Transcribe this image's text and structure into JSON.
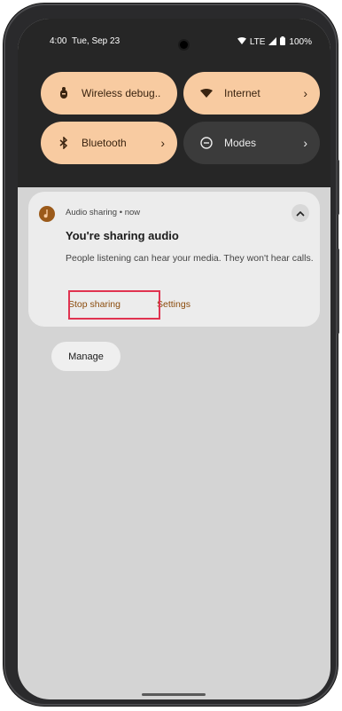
{
  "status_bar": {
    "time": "4:00",
    "date": "Tue, Sep 23",
    "network": "LTE",
    "battery": "100%"
  },
  "quick_tiles": [
    {
      "label": "Wireless debug..",
      "icon": "bug-icon",
      "active": true,
      "has_chevron": false
    },
    {
      "label": "Internet",
      "icon": "wifi-icon",
      "active": true,
      "has_chevron": true
    },
    {
      "label": "Bluetooth",
      "icon": "bluetooth-icon",
      "active": true,
      "has_chevron": true
    },
    {
      "label": "Modes",
      "icon": "modes-icon",
      "active": false,
      "has_chevron": true
    }
  ],
  "notification": {
    "app_name": "Audio sharing",
    "time": "now",
    "title": "You're sharing audio",
    "body": "People listening can hear your media. They won't hear calls.",
    "actions": [
      "Stop sharing",
      "Settings"
    ]
  },
  "manage_label": "Manage",
  "colors": {
    "tile_active": "#f8cba1",
    "tile_inactive": "#3b3b3b",
    "accent_text": "#8a4a0a",
    "highlight": "#e03350"
  }
}
